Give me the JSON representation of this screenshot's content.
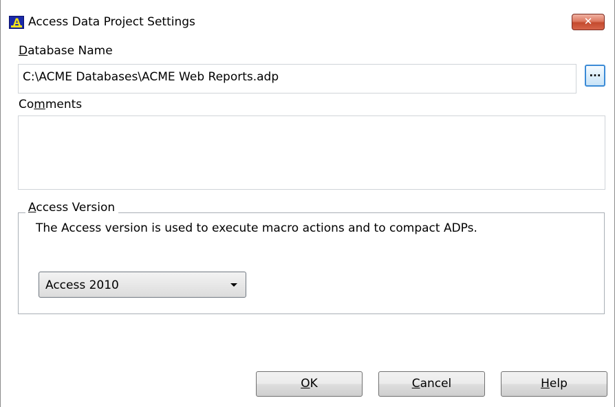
{
  "window": {
    "title": "Access Data Project Settings",
    "app_icon_letters": "A",
    "close_glyph": "✕"
  },
  "database_name": {
    "label_accel": "D",
    "label_rest": "atabase Name",
    "value": "C:\\ACME Databases\\ACME Web Reports.adp",
    "browse_label": "..."
  },
  "comments": {
    "label_pre": "Co",
    "label_accel": "m",
    "label_post": "ments",
    "value": ""
  },
  "access_version": {
    "legend_accel": "A",
    "legend_rest": "ccess Version",
    "description": "The Access version is used to execute macro actions and to compact ADPs.",
    "selected": "Access 2010"
  },
  "buttons": {
    "ok_accel": "O",
    "ok_rest": "K",
    "cancel_accel": "C",
    "cancel_rest": "ancel",
    "help_accel": "H",
    "help_rest": "elp"
  },
  "colors": {
    "close_button": "#c44a2e",
    "icon_background": "#1a2aa8",
    "icon_foreground": "#f4e21a",
    "browse_border": "#3a8ad6"
  }
}
